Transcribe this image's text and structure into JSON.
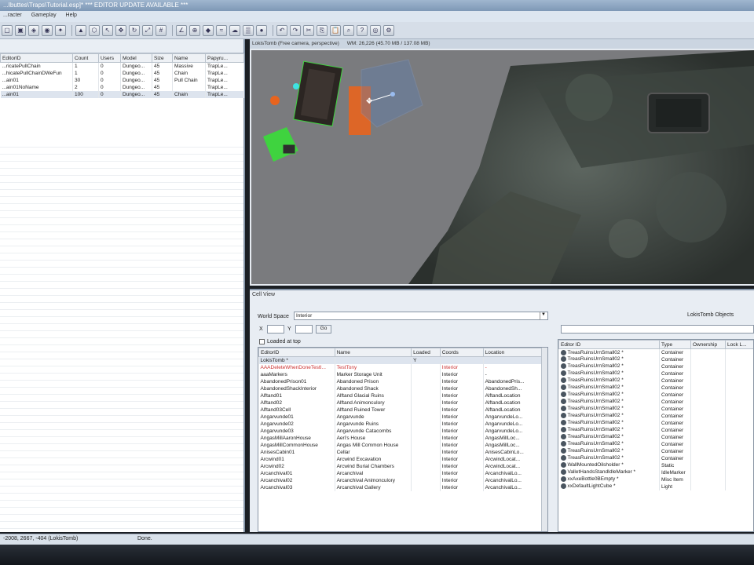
{
  "window": {
    "title": "...Ibuttes\\Traps\\Tutorial.esp]* *** EDITOR UPDATE AVAILABLE ***"
  },
  "menu": [
    "...racter",
    "Gameplay",
    "Help"
  ],
  "toolbar_icons": [
    "open-icon",
    "save-icon",
    "preferences-icon",
    "render-icon",
    "light-icon",
    "landscape-icon",
    "navmesh-icon",
    "pick-icon",
    "move-icon",
    "rotate-icon",
    "scale-icon",
    "snap-grid-icon",
    "snap-angle-icon",
    "snap-ref-icon",
    "marker-icon",
    "water-icon",
    "sky-icon",
    "fog-icon",
    "havok-icon",
    "undo-icon",
    "redo-icon",
    "cut-icon",
    "copy-icon",
    "paste-icon",
    "find-icon",
    "help-icon",
    "camera-icon",
    "settings-icon"
  ],
  "object_list": {
    "columns": [
      "EditorID",
      "Count",
      "Users",
      "Model",
      "Size",
      "Name",
      "Papyru..."
    ],
    "rows": [
      [
        "...ricatePullChain",
        "1",
        "0",
        "Dungeo...",
        "45",
        "Massive",
        "TrapLe..."
      ],
      [
        "...hicatePullChainDWeFun",
        "1",
        "0",
        "Dungeo...",
        "45",
        "Chain",
        "TrapLe..."
      ],
      [
        "...ain01",
        "30",
        "0",
        "Dungeo...",
        "45",
        "Pull Chain",
        "TrapLe..."
      ],
      [
        "...ain01NoName",
        "2",
        "0",
        "Dungeo...",
        "45",
        "",
        "TrapLe..."
      ],
      [
        "...ain01",
        "100",
        "0",
        "Dungeo...",
        "45",
        "Chain",
        "TrapLe..."
      ]
    ]
  },
  "render_window": {
    "tab": "LokisTomb (Free camera, perspective)",
    "info": "WM: 26,226 (45.70 MB / 137.08 MB)"
  },
  "cell_view": {
    "title": "Cell View",
    "worldspace_label": "World Space",
    "worldspace_value": "Interior",
    "x_label": "X",
    "y_label": "Y",
    "go_label": "Go",
    "loaded_label": "Loaded at top",
    "objects_title": "LokisTomb Objects",
    "cell_columns": [
      "EditorID",
      "Name",
      "Loaded",
      "Coords",
      "Location"
    ],
    "cell_rows": [
      [
        "LokisTomb *",
        "",
        "Y",
        "",
        ""
      ],
      [
        "AAADeleteWhenDoneTestI...",
        "TestTony",
        "",
        "Interior",
        "-"
      ],
      [
        "aaaMarkers",
        "Marker Storage Unit",
        "",
        "Interior",
        "-"
      ],
      [
        "AbandonedPrison01",
        "Abandoned Prison",
        "",
        "Interior",
        "AbandonedPris..."
      ],
      [
        "AbandonedShackInterior",
        "Abandoned Shack",
        "",
        "Interior",
        "AbandonedSh..."
      ],
      [
        "Alftand01",
        "Alftand Glacial Ruins",
        "",
        "Interior",
        "AlftandLocation"
      ],
      [
        "Alftand02",
        "Alftand Animonculory",
        "",
        "Interior",
        "AlftandLocation"
      ],
      [
        "Alftand03Cell",
        "Alftand Ruined Tower",
        "",
        "Interior",
        "AlftandLocation"
      ],
      [
        "Angarvunde01",
        "Angarvunde",
        "",
        "Interior",
        "AngarvundeLo..."
      ],
      [
        "Angarvunde02",
        "Angarvunde Ruins",
        "",
        "Interior",
        "AngarvundeLo..."
      ],
      [
        "Angarvunde03",
        "Angarvunde Catacombs",
        "",
        "Interior",
        "AngarvundeLo..."
      ],
      [
        "AngasMillAaronHouse",
        "Aeri's House",
        "",
        "Interior",
        "AngasMillLoc..."
      ],
      [
        "AngasMillCommonHouse",
        "Angas Mill Common House",
        "",
        "Interior",
        "AngasMillLoc..."
      ],
      [
        "AnisesCabin01",
        "Cellar",
        "",
        "Interior",
        "AnisesCabinLo..."
      ],
      [
        "Arcwind01",
        "Arcwind Excavation",
        "",
        "Interior",
        "ArcwindLocat..."
      ],
      [
        "Arcwind02",
        "Arcwind Burial Chambers",
        "",
        "Interior",
        "ArcwindLocat..."
      ],
      [
        "Arcanchival01",
        "Arcanchival",
        "",
        "Interior",
        "ArcanchivalLo..."
      ],
      [
        "Arcanchival02",
        "Arcanchival Animonculory",
        "",
        "Interior",
        "ArcanchivalLo..."
      ],
      [
        "Arcanchival03",
        "Arcanchival Gallery",
        "",
        "Interior",
        "ArcanchivalLo..."
      ]
    ],
    "obj_columns": [
      "Editor ID",
      "Type",
      "Ownership",
      "Lock L..."
    ],
    "obj_rows": [
      [
        "TreasRuinsUrnSmall02 *",
        "Container"
      ],
      [
        "TreasRuinsUrnSmall02 *",
        "Container"
      ],
      [
        "TreasRuinsUrnSmall02 *",
        "Container"
      ],
      [
        "TreasRuinsUrnSmall02 *",
        "Container"
      ],
      [
        "TreasRuinsUrnSmall02 *",
        "Container"
      ],
      [
        "TreasRuinsUrnSmall02 *",
        "Container"
      ],
      [
        "TreasRuinsUrnSmall02 *",
        "Container"
      ],
      [
        "TreasRuinsUrnSmall02 *",
        "Container"
      ],
      [
        "TreasRuinsUrnSmall02 *",
        "Container"
      ],
      [
        "TreasRuinsUrnSmall02 *",
        "Container"
      ],
      [
        "TreasRuinsUrnSmall02 *",
        "Container"
      ],
      [
        "TreasRuinsUrnSmall02 *",
        "Container"
      ],
      [
        "TreasRuinsUrnSmall02 *",
        "Container"
      ],
      [
        "TreasRuinsUrnSmall02 *",
        "Container"
      ],
      [
        "TreasRuinsUrnSmall02 *",
        "Container"
      ],
      [
        "TreasRuinsUrnSmall02 *",
        "Container"
      ],
      [
        "WallMountedOilsholder *",
        "Static"
      ],
      [
        "ValletHandsStandIdleMarker *",
        "IdleMarker"
      ],
      [
        "xxAxeBottle0BEmpty *",
        "Misc Item"
      ],
      [
        "xxDefaultLightCube *",
        "Light"
      ]
    ]
  },
  "status": {
    "coords": "-2008, 2667, -404 (LokisTomb)",
    "message": "Done."
  },
  "colors": {
    "viewport_bg": "#7a7b7e",
    "selection_orange": "#e8641e",
    "selection_blue": "#5a7fb8",
    "gizmo_green": "#3fd33f"
  }
}
